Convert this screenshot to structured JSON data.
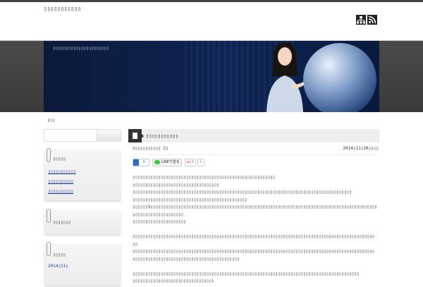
{
  "header": {
    "site_title": "▯▯▯▯▯▯▯▯▯▯▯",
    "sitemap_icon": "sitemap-icon",
    "rss_icon": "rss-icon"
  },
  "banner": {
    "tagline": "▯▯▯▯▯▯▯▯▯▯▯▯▯▯▯▯▯▯▯▯▯▯"
  },
  "breadcrumb": "▯▯▯",
  "sidebar": {
    "widgets": [
      {
        "title": "▯▯▯▯▯",
        "links": [
          "▯▯▯▯▯▯▯▯▯▯▯",
          "▯▯▯▯▯▯▯▯▯▯",
          "▯▯▯▯▯▯▯▯▯▯"
        ]
      },
      {
        "title": "▯▯▯▯▯▯▯"
      },
      {
        "title": "▯▯▯▯▯",
        "links": [
          "2014▯11▯"
        ]
      }
    ]
  },
  "post": {
    "title": "▯▯▯▯▯▯▯▯▯▯▯",
    "meta": "▯▯▯▯▯▯▯▯▯▯▯ 2▯",
    "date": "2014▯11▯20▯▯▯▯",
    "share": {
      "hatena_count": "0",
      "line_label": "LINEで送る",
      "gplus_label": "g+1",
      "gplus_count": "0"
    },
    "body": [
      "▯▯▯▯▯▯▯▯▯▯▯▯▯▯▯▯▯▯▯▯▯▯▯▯▯▯▯▯▯▯▯▯▯▯▯▯▯▯▯▯▯▯▯▯▯▯▯▯▯▯▯▯▯▯▯▯",
      "▯▯▯▯▯▯▯▯▯▯▯▯▯▯▯▯▯▯▯▯▯▯▯▯▯▯▯▯▯▯▯▯▯▯",
      "▯▯▯▯▯▯▯▯▯▯▯▯▯▯▯▯▯▯▯▯▯▯▯▯▯▯▯▯▯▯▯▯▯▯▯▯▯▯▯▯▯▯▯▯▯▯▯▯▯▯▯▯▯▯▯▯▯▯▯▯▯▯▯▯▯▯▯▯▯▯▯▯▯▯▯▯▯▯▯▯▯▯▯▯▯▯",
      "▯▯▯▯▯▯▯▯▯▯▯▯▯▯▯▯▯▯▯▯▯▯▯▯▯▯▯▯▯▯▯▯▯▯▯▯▯▯▯▯▯▯▯▯▯",
      "▯▯▯▯▯▯3▯▯▯▯▯▯▯▯▯▯▯▯▯▯▯▯▯▯▯▯▯▯▯▯▯▯▯▯▯▯▯▯▯▯▯▯▯▯▯▯▯▯▯▯▯▯▯▯▯▯▯▯▯▯▯▯▯▯▯▯▯▯▯▯▯▯▯▯▯▯▯▯▯▯▯▯▯▯▯▯▯▯▯▯▯▯▯▯▯",
      "▯▯▯▯▯▯▯▯▯▯▯▯▯▯▯▯▯▯▯▯",
      "▯▯▯▯▯▯▯▯▯▯▯▯▯▯▯▯▯▯▯▯▯",
      "",
      "▯▯▯▯▯▯▯▯▯▯▯▯▯▯▯▯▯▯▯▯▯▯▯▯▯▯▯▯▯▯▯▯▯▯▯▯▯▯▯▯▯▯▯▯▯▯▯▯▯▯▯▯▯▯▯▯▯▯▯▯▯▯▯▯▯▯▯▯▯▯▯▯▯▯▯▯▯▯▯▯▯▯▯▯▯▯▯▯▯▯▯▯▯▯▯",
      "▯▯",
      "▯▯▯▯▯▯▯▯▯▯▯▯▯▯▯▯▯▯▯▯▯▯▯▯▯▯▯▯▯▯▯▯▯▯▯▯▯▯▯▯▯▯▯▯▯▯▯▯▯▯▯▯▯▯▯▯▯▯▯▯▯▯▯▯▯▯▯▯▯▯▯▯▯▯▯▯▯▯▯▯▯▯▯▯▯▯▯▯▯▯▯▯▯▯▯",
      "▯▯▯▯▯▯▯▯▯▯▯▯▯▯▯▯▯▯▯▯▯▯▯▯▯▯▯▯▯▯▯▯▯▯▯▯▯▯▯▯▯▯",
      "",
      "▯▯▯▯▯▯▯▯▯▯▯▯▯▯▯▯▯▯▯▯▯▯▯▯▯▯▯▯▯▯▯▯▯▯▯▯▯▯▯▯▯▯▯▯▯▯▯▯▯▯▯▯▯▯▯▯▯▯▯▯▯▯▯▯▯▯▯▯▯▯▯▯▯▯▯▯▯▯▯▯▯▯▯▯▯▯▯▯▯",
      "▯▯▯▯▯▯▯▯▯▯▯▯▯▯▯▯▯▯▯▯▯▯▯▯▯▯▯▯▯▯▯▯"
    ]
  },
  "colors": {
    "banner": "#0e2454",
    "link": "#1a3a9a",
    "frame": "#444444"
  }
}
